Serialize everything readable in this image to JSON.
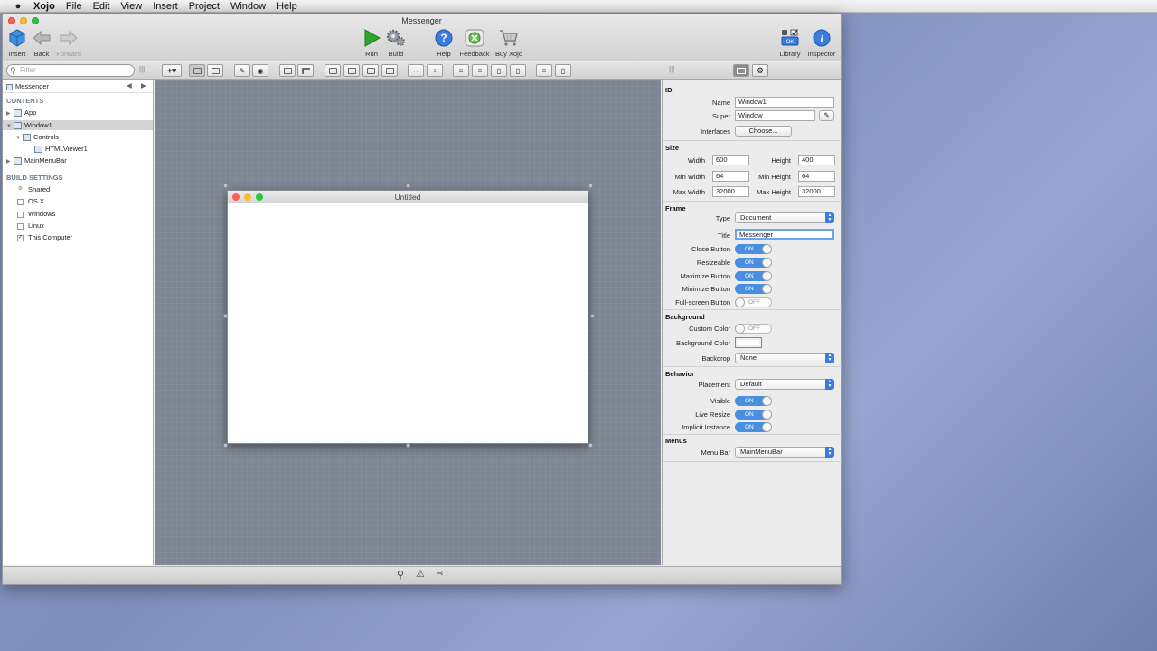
{
  "menubar": {
    "app": "Xojo",
    "items": [
      "File",
      "Edit",
      "View",
      "Insert",
      "Project",
      "Window",
      "Help"
    ]
  },
  "window": {
    "title": "Messenger"
  },
  "toolbar": {
    "insert": "Insert",
    "back": "Back",
    "forward": "Forward",
    "run": "Run",
    "build": "Build",
    "help": "Help",
    "feedback": "Feedback",
    "buy": "Buy Xojo",
    "library": "Library",
    "inspector": "Inspector"
  },
  "filter": {
    "placeholder": "Filter"
  },
  "navigator": {
    "project": "Messenger",
    "contents_header": "CONTENTS",
    "app": "App",
    "window1": "Window1",
    "controls": "Controls",
    "htmlviewer": "HTMLViewer1",
    "menubar": "MainMenuBar",
    "build_header": "BUILD SETTINGS",
    "shared": "Shared",
    "osx": "OS X",
    "windows": "Windows",
    "linux": "Linux",
    "this_computer": "This Computer",
    "this_computer_checked": true
  },
  "designer": {
    "window_title": "Untitled"
  },
  "inspector": {
    "id": {
      "header": "ID",
      "name_label": "Name",
      "name": "Window1",
      "super_label": "Super",
      "super": "Window",
      "interfaces_label": "Interfaces",
      "choose": "Choose..."
    },
    "size": {
      "header": "Size",
      "width_label": "Width",
      "width": "600",
      "height_label": "Height",
      "height": "400",
      "minw_label": "Min Width",
      "minw": "64",
      "minh_label": "Min Height",
      "minh": "64",
      "maxw_label": "Max Width",
      "maxw": "32000",
      "maxh_label": "Max Height",
      "maxh": "32000"
    },
    "frame": {
      "header": "Frame",
      "type_label": "Type",
      "type": "Document",
      "title_label": "Title",
      "title": "Messenger",
      "close_label": "Close Button",
      "resize_label": "Resizeable",
      "max_label": "Maximize Button",
      "min_label": "Minimize Button",
      "full_label": "Full-screen Button"
    },
    "background": {
      "header": "Background",
      "custom_label": "Custom Color",
      "bgcolor_label": "Background Color",
      "backdrop_label": "Backdrop",
      "backdrop": "None"
    },
    "behavior": {
      "header": "Behavior",
      "placement_label": "Placement",
      "placement": "Default",
      "visible_label": "Visible",
      "live_label": "Live Resize",
      "implicit_label": "Implicit Instance"
    },
    "menus": {
      "header": "Menus",
      "menubar_label": "Menu Bar",
      "menubar": "MainMenuBar"
    },
    "on": "ON",
    "off": "OFF"
  },
  "colors": {
    "accent": "#4a8ee0",
    "canvas": "#7d8692"
  }
}
